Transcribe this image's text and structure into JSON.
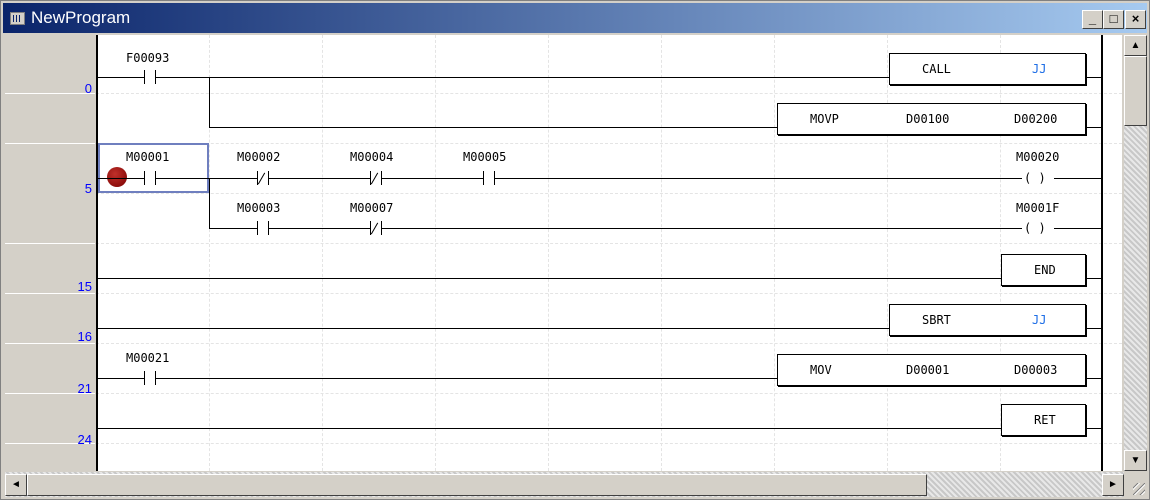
{
  "window": {
    "title": "NewProgram",
    "controls": {
      "minimize": "_",
      "restore": "□",
      "close": "×"
    }
  },
  "rung_numbers": [
    "0",
    "5",
    "15",
    "16",
    "21",
    "24"
  ],
  "contacts": [
    {
      "label": "F00093",
      "type": "NO"
    },
    {
      "label": "M00001",
      "type": "NO",
      "breakpoint": true,
      "selected": true
    },
    {
      "label": "M00002",
      "type": "NC"
    },
    {
      "label": "M00004",
      "type": "NC"
    },
    {
      "label": "M00005",
      "type": "NO"
    },
    {
      "label": "M00003",
      "type": "NO"
    },
    {
      "label": "M00007",
      "type": "NC"
    },
    {
      "label": "M00021",
      "type": "NO"
    }
  ],
  "coils": [
    {
      "label": "M00020",
      "symbol": "( )"
    },
    {
      "label": "M0001F",
      "symbol": "( )"
    }
  ],
  "function_blocks": [
    {
      "op": "CALL",
      "args": [
        "JJ"
      ]
    },
    {
      "op": "MOVP",
      "args": [
        "D00100",
        "D00200"
      ]
    },
    {
      "op": "END",
      "args": []
    },
    {
      "op": "SBRT",
      "args": [
        "JJ"
      ]
    },
    {
      "op": "MOV",
      "args": [
        "D00001",
        "D00003"
      ]
    },
    {
      "op": "RET",
      "args": []
    }
  ],
  "colors": {
    "title_start": "#0a246a",
    "title_end": "#a6caf0",
    "rung_number": "#0000ff",
    "label_arg": "#1e6ee6",
    "breakpoint": "#8b0000",
    "selection": "#6f7fbf"
  },
  "scrollbars": {
    "up_icon": "▲",
    "down_icon": "▼",
    "left_icon": "◄",
    "right_icon": "►"
  }
}
